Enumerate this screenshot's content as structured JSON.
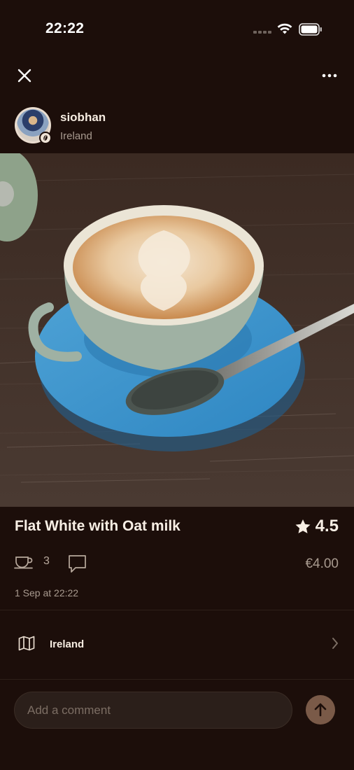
{
  "status_bar": {
    "time": "22:22"
  },
  "nav": {
    "close_icon": "close-icon",
    "more_icon": "more-horizontal-icon"
  },
  "user": {
    "name": "siobhan",
    "location": "Ireland"
  },
  "post": {
    "title": "Flat White with Oat milk",
    "rating": "4.5",
    "cups_count": "3",
    "price": "€4.00",
    "date": "1 Sep at 22:22"
  },
  "location_row": {
    "label": "Ireland"
  },
  "comment": {
    "placeholder": "Add a comment"
  },
  "colors": {
    "background": "#1c0e0a",
    "accent": "#7a5a48",
    "text": "#f8efe5",
    "muted": "#a89a8f"
  }
}
